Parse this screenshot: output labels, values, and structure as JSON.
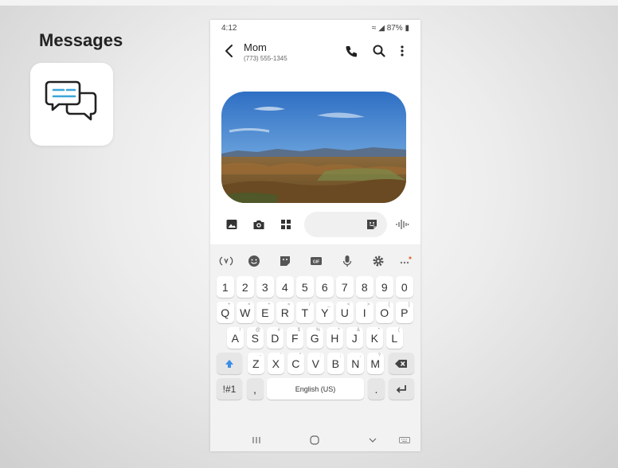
{
  "page": {
    "title": "Messages"
  },
  "status_bar": {
    "time": "4:12",
    "battery": "87%"
  },
  "conversation": {
    "contact_name": "Mom",
    "contact_number": "(773) 555-1345"
  },
  "composer": {
    "placeholder": ""
  },
  "keyboard": {
    "number_row": [
      "1",
      "2",
      "3",
      "4",
      "5",
      "6",
      "7",
      "8",
      "9",
      "0"
    ],
    "row1": [
      {
        "key": "Q",
        "hint": "+"
      },
      {
        "key": "W",
        "hint": "×"
      },
      {
        "key": "E",
        "hint": "÷"
      },
      {
        "key": "R",
        "hint": "="
      },
      {
        "key": "T",
        "hint": "/"
      },
      {
        "key": "Y",
        "hint": "_"
      },
      {
        "key": "U",
        "hint": "<"
      },
      {
        "key": "I",
        "hint": ">"
      },
      {
        "key": "O",
        "hint": "["
      },
      {
        "key": "P",
        "hint": "]"
      }
    ],
    "row2": [
      {
        "key": "A",
        "hint": "!"
      },
      {
        "key": "S",
        "hint": "@"
      },
      {
        "key": "D",
        "hint": "#"
      },
      {
        "key": "F",
        "hint": "$"
      },
      {
        "key": "G",
        "hint": "%"
      },
      {
        "key": "H",
        "hint": "^"
      },
      {
        "key": "J",
        "hint": "&"
      },
      {
        "key": "K",
        "hint": "*"
      },
      {
        "key": "L",
        "hint": "("
      }
    ],
    "row3": [
      {
        "key": "Z",
        "hint": "-"
      },
      {
        "key": "X",
        "hint": "'"
      },
      {
        "key": "C",
        "hint": "\""
      },
      {
        "key": "V",
        "hint": ":"
      },
      {
        "key": "B",
        "hint": ";"
      },
      {
        "key": "N",
        "hint": ","
      },
      {
        "key": "M",
        "hint": "?"
      }
    ],
    "symbols_label": "!#1",
    "comma_label": ",",
    "space_label": "English (US)",
    "period_label": "."
  },
  "colors": {
    "accent": "#3a8ee6",
    "keyboard_bg": "#f2f2f2",
    "key_bg": "#ffffff"
  }
}
